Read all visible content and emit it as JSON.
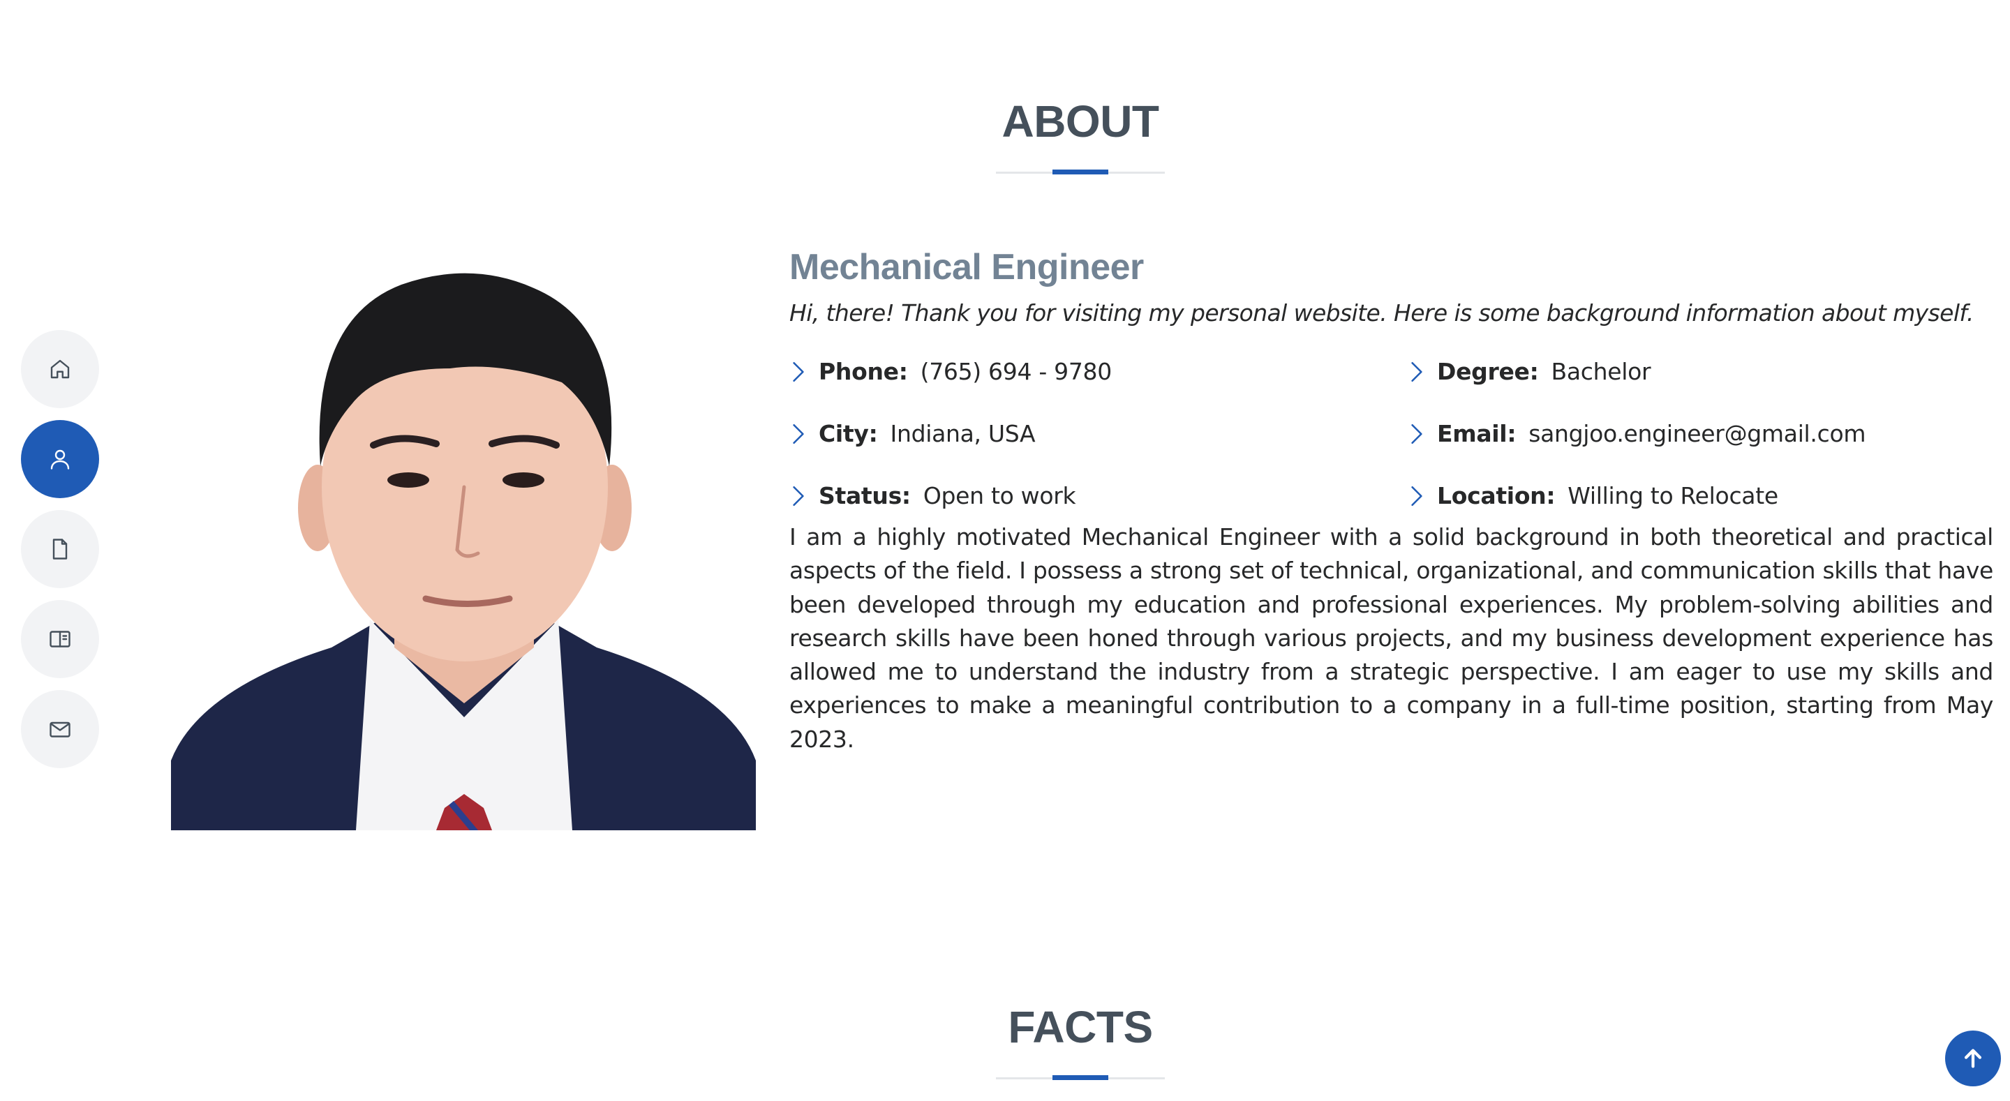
{
  "nav": {
    "items": [
      {
        "icon": "home-icon",
        "active": false
      },
      {
        "icon": "person-icon",
        "active": true
      },
      {
        "icon": "file-icon",
        "active": false
      },
      {
        "icon": "book-icon",
        "active": false
      },
      {
        "icon": "envelope-icon",
        "active": false
      }
    ]
  },
  "about": {
    "title": "ABOUT",
    "role": "Mechanical Engineer",
    "intro": "Hi, there! Thank you for visiting my personal website. Here is some background information about myself.",
    "info": {
      "phone": {
        "label": "Phone:",
        "value": "(765) 694 - 9780"
      },
      "city": {
        "label": "City:",
        "value": "Indiana, USA"
      },
      "status": {
        "label": "Status:",
        "value": "Open to work"
      },
      "degree": {
        "label": "Degree:",
        "value": "Bachelor"
      },
      "email": {
        "label": "Email:",
        "value": "sangjoo.engineer@gmail.com"
      },
      "location": {
        "label": "Location:",
        "value": "Willing to Relocate"
      }
    },
    "bio": "I am a highly motivated Mechanical Engineer with a solid background in both theoretical and practical aspects of the field. I possess a strong set of technical, organizational, and communication skills that have been developed through my education and professional experiences. My problem-solving abilities and research skills have been honed through various projects, and my business development experience has allowed me to understand the industry from a strategic perspective. I am eager to use my skills and experiences to make a meaningful contribution to a company in a full-time position, starting from May 2023."
  },
  "facts": {
    "title": "FACTS"
  },
  "colors": {
    "accent": "#1f5bb5",
    "heading": "#45505b",
    "subheading": "#728394",
    "text": "#272829",
    "nav_bg": "#f2f3f5"
  }
}
